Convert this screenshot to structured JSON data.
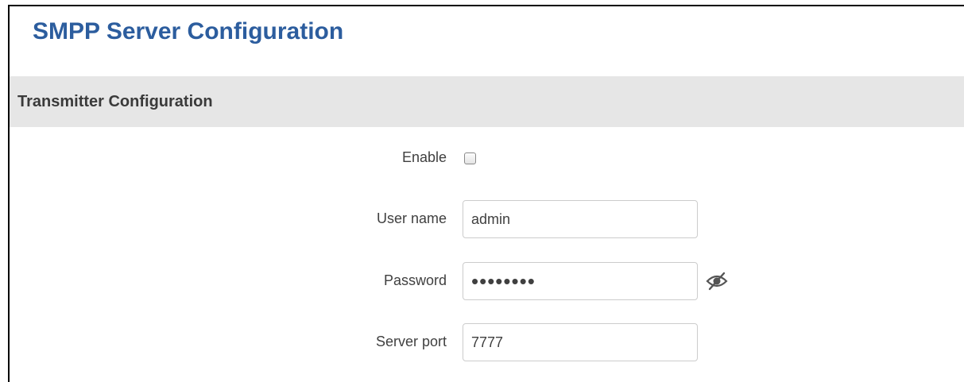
{
  "page": {
    "title": "SMPP Server Configuration"
  },
  "section": {
    "title": "Transmitter Configuration"
  },
  "form": {
    "enable": {
      "label": "Enable",
      "checked": false
    },
    "username": {
      "label": "User name",
      "value": "admin"
    },
    "password": {
      "label": "Password",
      "value": "••••••••",
      "toggle_icon": "eye-slash-icon"
    },
    "server_port": {
      "label": "Server port",
      "value": "7777"
    }
  },
  "colors": {
    "title": "#2c5d9e",
    "section_bg": "#e6e6e6",
    "label_text": "#404040",
    "input_border": "#cccccc"
  }
}
